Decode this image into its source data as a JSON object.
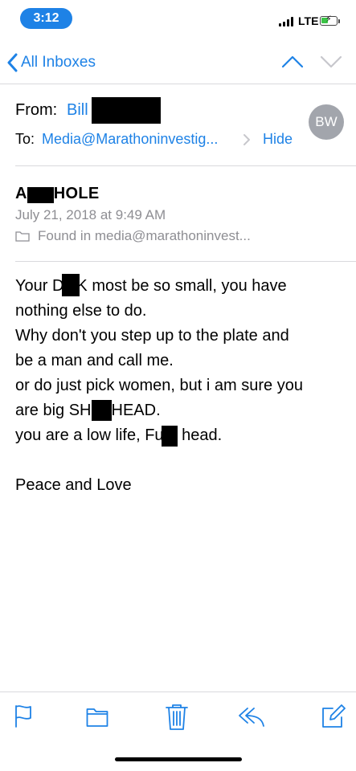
{
  "status_bar": {
    "time": "3:12",
    "network": "LTE"
  },
  "nav": {
    "back_label": "All Inboxes"
  },
  "header": {
    "from_label": "From:",
    "from_name": "Bill",
    "avatar_initials": "BW",
    "to_label": "To:",
    "to_address": "Media@Marathoninvestig...",
    "hide_label": "Hide"
  },
  "message": {
    "subject_start": "A",
    "subject_end": "HOLE",
    "date": "July 21, 2018 at 9:49 AM",
    "found_in": "Found in media@marathoninvest...",
    "body": {
      "l1a": "Your D",
      "l1b": "K most be so small, you have",
      "l2": "nothing else to do.",
      "l3": "Why don't you step up to the plate and",
      "l4": "be a man and call me.",
      "l5": "or do just pick women, but i am sure you",
      "l6a": "are big SH",
      "l6b": "HEAD.",
      "l7a": "you are a low life, Fu",
      "l7b": " head.",
      "l8": "Peace and Love"
    }
  },
  "toolbar": {
    "icons": [
      "flag-icon",
      "folder-icon",
      "trash-icon",
      "reply-icon",
      "compose-icon"
    ]
  },
  "colors": {
    "accent": "#1e82e6",
    "secondary_text": "#8e8e93",
    "avatar_bg": "#a2a5ac"
  }
}
